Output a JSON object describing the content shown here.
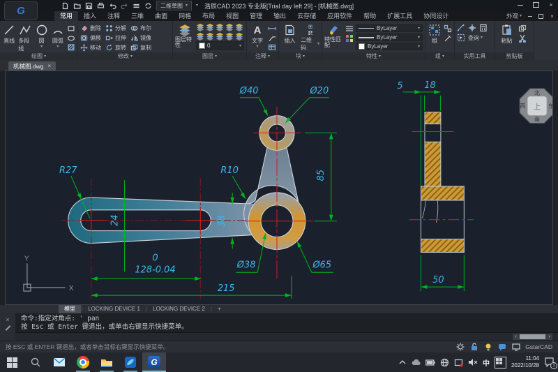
{
  "window": {
    "title": "浩辰CAD 2023 专业版[Trial day left 29] - [机械图.dwg]",
    "workspace": "二维草图",
    "appearance_menu": "外观"
  },
  "menu_tabs": {
    "items": [
      "常用",
      "插入",
      "注释",
      "三维",
      "曲面",
      "网格",
      "布局",
      "视图",
      "管理",
      "输出",
      "云存储",
      "应用软件",
      "帮助",
      "扩展工具",
      "协同设计"
    ],
    "active": "常用"
  },
  "ribbon": {
    "draw": {
      "label": "绘图",
      "line": "直线",
      "polyline": "多段线",
      "circle": "圆",
      "arc": "圆弧"
    },
    "modify": {
      "label": "修改",
      "erase": "删除",
      "explode": "分解",
      "boolean": "布尔",
      "offset": "偏移",
      "stretch": "拉伸",
      "mirror": "镜像",
      "move": "移动",
      "rotate": "旋转",
      "copy": "复制"
    },
    "layer": {
      "label": "图层",
      "properties": "图层特性",
      "current": "0"
    },
    "annotate": {
      "label": "注释",
      "text": "文字"
    },
    "block": {
      "label": "块",
      "insert": "插入",
      "qrcode": "二维码"
    },
    "properties": {
      "label": "特性",
      "match": "特性匹配",
      "bylayer1": "ByLayer",
      "bylayer2": "ByLayer",
      "bylayer3": "ByLayer"
    },
    "group": {
      "label": "组",
      "group_btn": "组"
    },
    "utilities": {
      "label": "实用工具",
      "query": "查询"
    },
    "clipboard": {
      "label": "剪贴板",
      "paste": "粘贴"
    }
  },
  "document_tab": {
    "name": "机械图.dwg"
  },
  "drawing": {
    "dims": {
      "top_outer": "Ø40",
      "top_inner": "Ø20",
      "left_radius": "R27",
      "fillet": "R10",
      "slot_width": "24",
      "arm_width": "38",
      "center_dist": "85",
      "boss_inner": "Ø38",
      "boss_outer": "Ø65",
      "tol_upper": "0",
      "length_tol": "128-0.04",
      "total_length": "215",
      "side_offset": "5",
      "side_width": "18",
      "side_base": "50"
    },
    "ucs": {
      "x": "X",
      "y": "Y"
    },
    "viewcube": {
      "top": "上",
      "north": "北",
      "south": "南",
      "east": "东",
      "west": "西"
    }
  },
  "layout_tabs": {
    "model": "模型",
    "tab1": "LOCKING DEVICE 1",
    "tab2": "LOCKING DEVICE 2",
    "add": "+"
  },
  "command": {
    "line1": "命令:指定对角点: '_pan",
    "line2": "按 Esc 或 Enter 键退出，或单击右键显示快捷菜单。"
  },
  "status": {
    "hint": "按 ESC 或 ENTER 键退出，或者单击鼠标右键显示快捷菜单。",
    "brand": "GstarCAD"
  },
  "taskbar": {
    "ime_lang": "中",
    "time": "11:04",
    "date": "2022/10/28",
    "badge": "1"
  },
  "colors": {
    "dim_line": "#00b41e",
    "dim_text": "#3fb6e8",
    "centerline": "#cc2020",
    "hatch": "#cf9a33",
    "part_teal": "#1d6a80",
    "part_steel": "#7e93a8"
  }
}
